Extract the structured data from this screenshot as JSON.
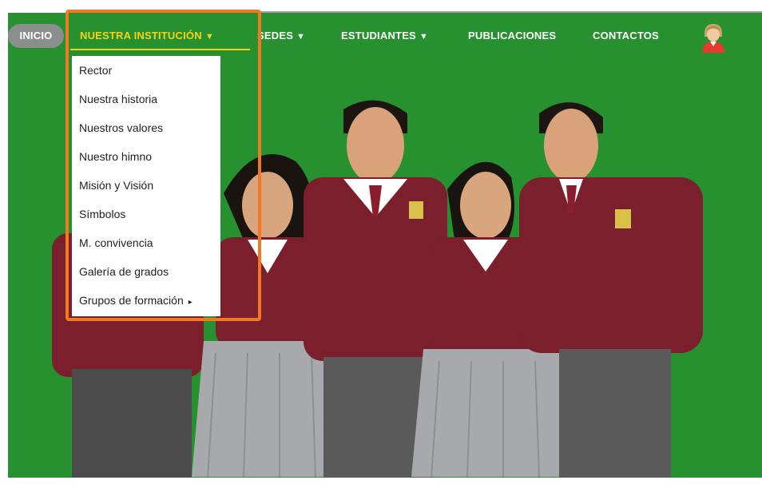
{
  "nav": {
    "inicio": "INICIO",
    "institucion": "NUESTRA INSTITUCIÓN",
    "sedes": "SEDES",
    "estudiantes": "ESTUDIANTES",
    "publicaciones": "PUBLICACIONES",
    "contactos": "CONTACTOS",
    "caret": "▼"
  },
  "dropdown": {
    "items": [
      "Rector",
      "Nuestra historia",
      "Nuestros valores",
      "Nuestro himno",
      "Misión y Visión",
      "Símbolos",
      "M. convivencia",
      "Galería de grados",
      "Grupos de formación"
    ],
    "submenu_arrow": "▸"
  },
  "colors": {
    "background_green": "#27912f",
    "active_yellow": "#f3d31a",
    "inicio_pill": "#8a8e8d",
    "highlight_orange": "#ef7a22",
    "uniform_maroon": "#7a1f2b"
  },
  "icons": {
    "user": "user-avatar-icon",
    "submenu": "caret-right-icon"
  }
}
